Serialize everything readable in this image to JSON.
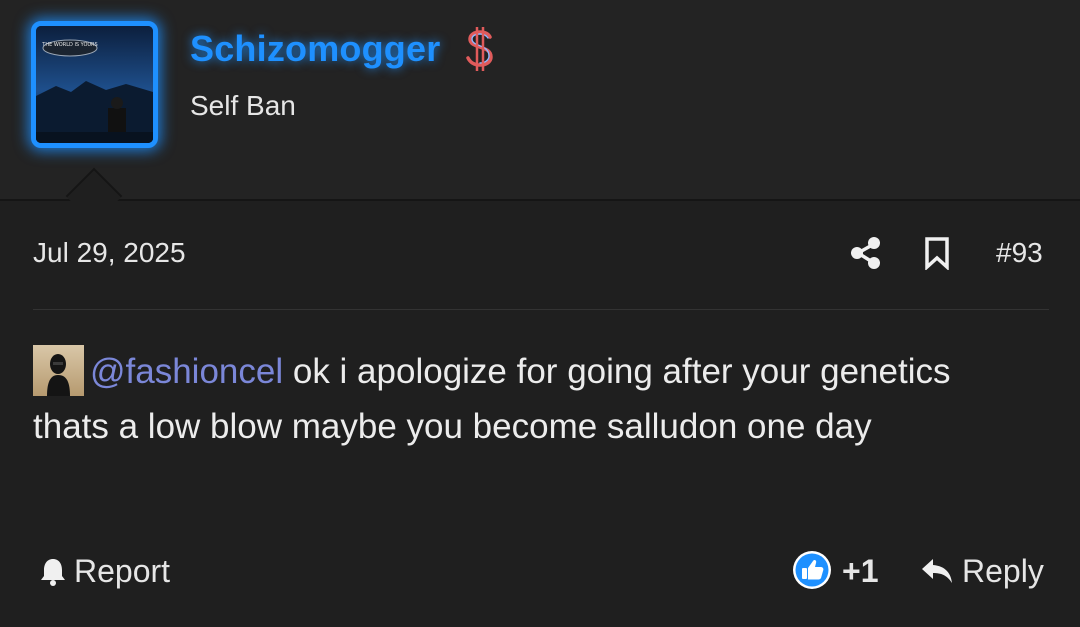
{
  "user": {
    "name": "Schizomogger",
    "title": "Self Ban",
    "avatar_sign_text": "THE WORLD IS YOURS",
    "accent_color": "#1e90ff",
    "badge_icon": "dollar-sign-icon"
  },
  "post": {
    "date": "Jul 29, 2025",
    "number": "#93",
    "mention": "@fashioncel",
    "body": " ok i apologize for going after your genetics thats a low blow maybe you become salludon one day"
  },
  "actions": {
    "share_icon": "share-icon",
    "bookmark_icon": "bookmark-icon",
    "report_label": "Report",
    "reaction_count": "+1",
    "reply_label": "Reply"
  },
  "colors": {
    "background": "#1f1f1f",
    "header_background": "#232323",
    "mention": "#7b87d8",
    "like_badge": "#1e90ff"
  }
}
